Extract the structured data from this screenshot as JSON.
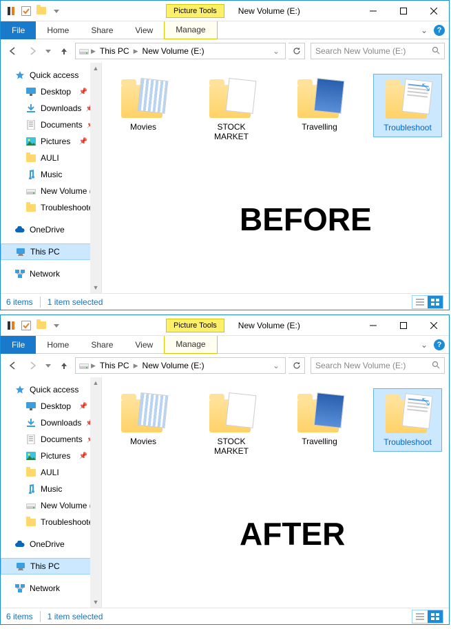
{
  "windows": [
    {
      "overlay_label": "BEFORE"
    },
    {
      "overlay_label": "AFTER"
    }
  ],
  "shared": {
    "context_tab": "Picture Tools",
    "title": "New Volume (E:)",
    "ribbon": {
      "file": "File",
      "home": "Home",
      "share": "Share",
      "view": "View",
      "manage": "Manage"
    },
    "breadcrumbs": [
      "This PC",
      "New Volume (E:)"
    ],
    "search_placeholder": "Search New Volume (E:)",
    "sidebar": {
      "quick_access": "Quick access",
      "items": [
        "Desktop",
        "Downloads",
        "Documents",
        "Pictures",
        "AULI",
        "Music",
        "New Volume (E:)",
        "Troubleshooter W"
      ],
      "onedrive": "OneDrive",
      "this_pc": "This PC",
      "network": "Network"
    },
    "content_items": [
      {
        "label": "Movies",
        "thumb": "striped",
        "selected": false
      },
      {
        "label": "STOCK MARKET",
        "thumb": "blank",
        "selected": false
      },
      {
        "label": "Travelling",
        "thumb": "blue",
        "selected": false
      },
      {
        "label": "Troubleshoot",
        "thumb": "doc",
        "selected": true
      }
    ],
    "status": {
      "items": "6 items",
      "selected": "1 item selected"
    }
  }
}
